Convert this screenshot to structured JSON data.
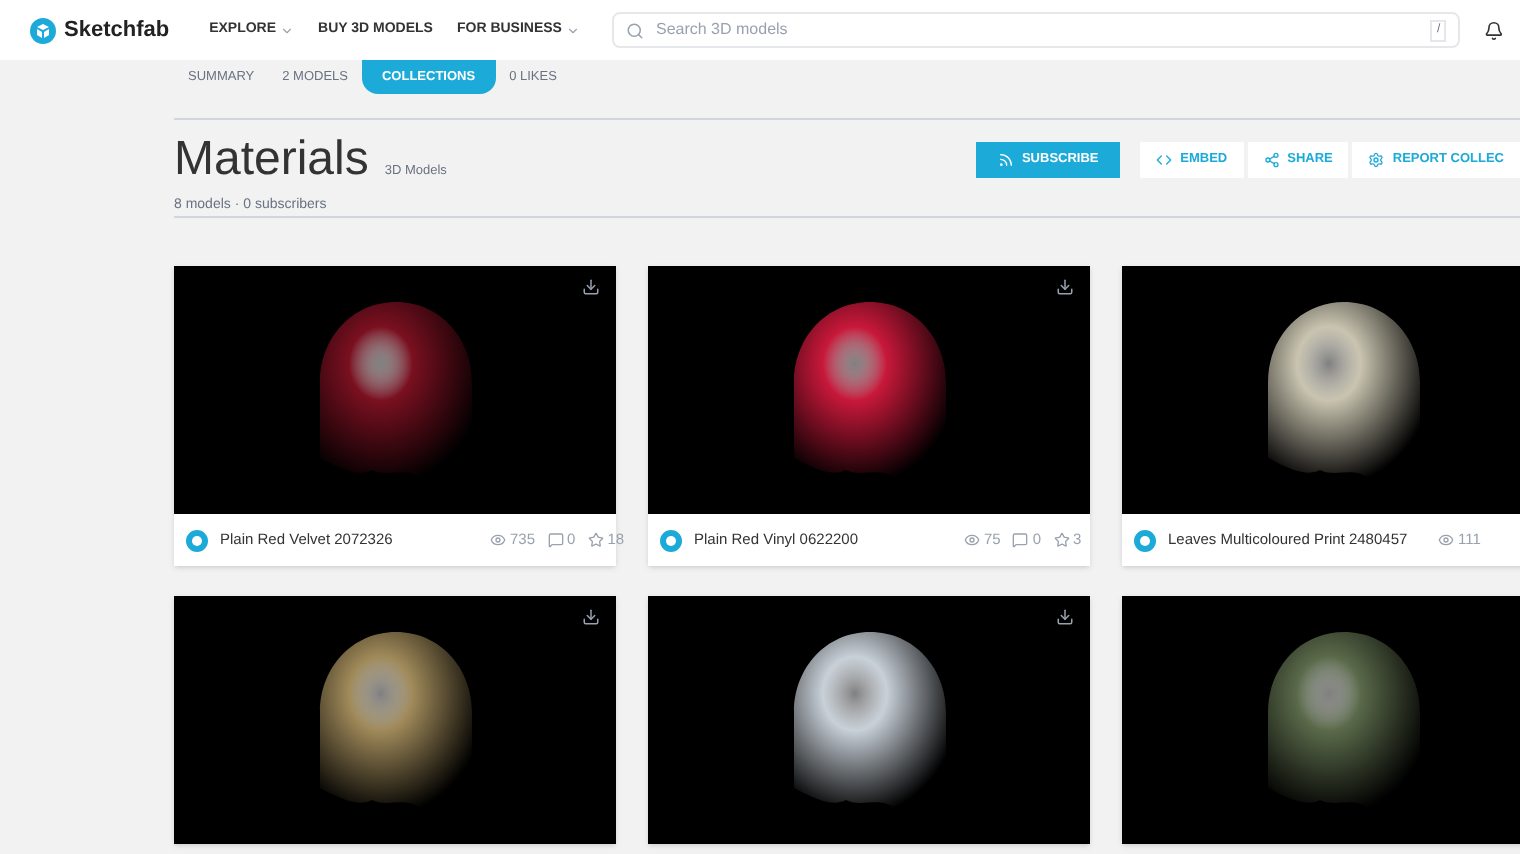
{
  "header": {
    "brand": "Sketchfab",
    "nav": [
      {
        "label": "EXPLORE",
        "dropdown": true
      },
      {
        "label": "BUY 3D MODELS",
        "dropdown": false
      },
      {
        "label": "FOR BUSINESS",
        "dropdown": true
      }
    ],
    "search": {
      "placeholder": "Search 3D models",
      "shortcut": "/"
    }
  },
  "tabs": [
    {
      "label": "SUMMARY",
      "selected": false
    },
    {
      "label": "2 MODELS",
      "selected": false
    },
    {
      "label": "COLLECTIONS",
      "selected": true
    },
    {
      "label": "0 LIKES",
      "selected": false
    }
  ],
  "collection": {
    "title": "Materials",
    "subtitle": "3D Models",
    "meta": "8 models · 0 subscribers"
  },
  "actions": [
    {
      "kind": "subscribe",
      "label": "SUBSCRIBE"
    },
    {
      "kind": "embed",
      "label": "EMBED"
    },
    {
      "kind": "share",
      "label": "SHARE"
    },
    {
      "kind": "report",
      "label": "REPORT COLLEC"
    }
  ],
  "models": [
    {
      "title": "Plain Red Velvet 2072326",
      "color": "#7a1020",
      "stats": [
        {
          "kind": "views",
          "value": "735"
        },
        {
          "kind": "comments",
          "value": "0"
        },
        {
          "kind": "likes",
          "value": "18"
        }
      ]
    },
    {
      "title": "Plain Red Vinyl 0622200",
      "color": "#c8183a",
      "stats": [
        {
          "kind": "views",
          "value": "75"
        },
        {
          "kind": "comments",
          "value": "0"
        },
        {
          "kind": "likes",
          "value": "3"
        }
      ]
    },
    {
      "title": "Leaves Multicoloured Print 2480457",
      "color": "#c9c4b0",
      "stats": [
        {
          "kind": "views",
          "value": "111"
        }
      ]
    },
    {
      "color": "#a08a5a"
    },
    {
      "color": "#c8d0d8"
    },
    {
      "color": "#5a6a4a"
    }
  ]
}
